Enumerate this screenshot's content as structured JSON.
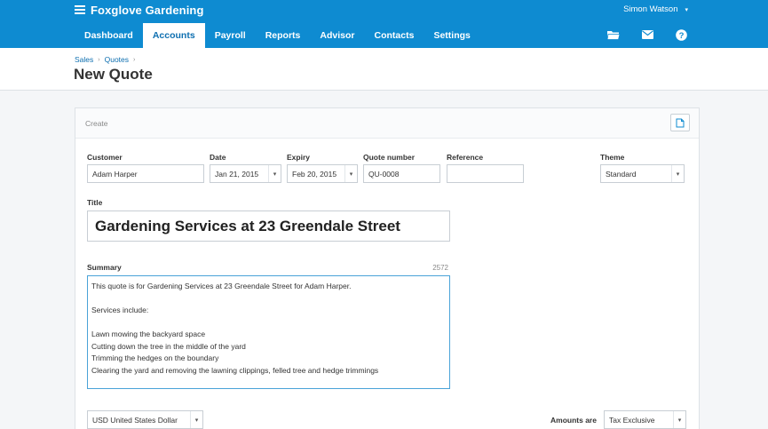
{
  "header": {
    "org_name": "Foxglove Gardening",
    "user_name": "Simon Watson",
    "user_caret": "▾"
  },
  "nav": {
    "tabs": [
      {
        "label": "Dashboard",
        "active": false
      },
      {
        "label": "Accounts",
        "active": true
      },
      {
        "label": "Payroll",
        "active": false
      },
      {
        "label": "Reports",
        "active": false
      },
      {
        "label": "Advisor",
        "active": false
      },
      {
        "label": "Contacts",
        "active": false
      },
      {
        "label": "Settings",
        "active": false
      }
    ],
    "icons": [
      "folder-icon",
      "mail-icon",
      "help-icon"
    ]
  },
  "breadcrumb": {
    "items": [
      "Sales",
      "Quotes"
    ],
    "separator": "›"
  },
  "page": {
    "title": "New Quote"
  },
  "form": {
    "section_label": "Create",
    "customer": {
      "label": "Customer",
      "value": "Adam Harper"
    },
    "date": {
      "label": "Date",
      "value": "Jan 21, 2015"
    },
    "expiry": {
      "label": "Expiry",
      "value": "Feb 20, 2015"
    },
    "quote_number": {
      "label": "Quote number",
      "value": "QU-0008"
    },
    "reference": {
      "label": "Reference",
      "value": ""
    },
    "theme": {
      "label": "Theme",
      "value": "Standard"
    },
    "title": {
      "label": "Title",
      "value": "Gardening Services at 23 Greendale Street"
    },
    "summary": {
      "label": "Summary",
      "count": "2572",
      "lines": [
        "This quote is for Gardening Services at 23 Greendale Street for Adam Harper.",
        "",
        "Services include:",
        "",
        "Lawn mowing the backyard space",
        "Cutting down the tree in the middle of the yard",
        "Trimming the hedges on the boundary",
        "Clearing the yard and removing the lawning clippings, felled tree and hedge trimmings"
      ]
    },
    "currency": {
      "value": "USD United States Dollar"
    },
    "amounts_are": {
      "label": "Amounts are",
      "value": "Tax Exclusive"
    },
    "dropdown_glyph": "▾"
  },
  "colors": {
    "brand_blue": "#0e8bd1",
    "active_tab_text": "#0e6fb0",
    "focus_border": "#4aa3d8"
  }
}
